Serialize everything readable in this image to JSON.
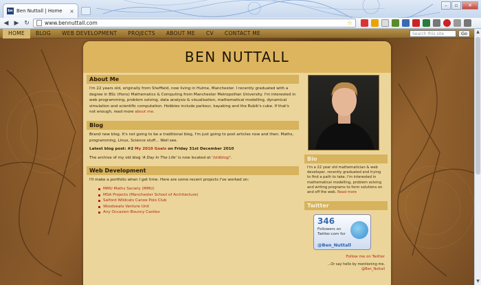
{
  "browser": {
    "tab_title": "Ben Nuttall | Home",
    "favicon_text": "bn",
    "url": "www.bennuttall.com"
  },
  "nav": {
    "items": [
      "HOME",
      "BLOG",
      "WEB DEVELOPMENT",
      "PROJECTS",
      "ABOUT ME",
      "CV",
      "CONTACT ME"
    ],
    "search_placeholder": "Search this site",
    "go_label": "Go"
  },
  "site": {
    "title": "BEN NUTTALL"
  },
  "about": {
    "heading": "About Me",
    "text": "I'm 22 years old, originally from Sheffield, now living in Hulme, Manchester. I recently graduated with a degree in BSc (Hons) Mathematics & Computing from Manchester Metropolitan University. I'm interested in web programming, problem solving, data analysis & visualisation, mathematical modelling, dynamical simulation and scientific computation. Hobbies include parkour, kayaking and the Rubik's cube. If that's not enough, read more",
    "link": "about me",
    "link_suffix": "."
  },
  "blog": {
    "heading": "Blog",
    "intro": "Brand new blog. It's not going to be a traditional blog, I'm just going to post articles now and then. Maths, programming, Linux, Science stuff... Well see.",
    "latest_prefix": "Latest blog post: #2",
    "latest_link": "My 2010 Goals",
    "latest_suffix": "on Friday 31st December 2010",
    "archive_prefix": "The archive of my old blog '",
    "archive_title": "A Day In The Life",
    "archive_mid": "' is now located at '",
    "archive_link": "/oldblog/",
    "archive_suffix": "'."
  },
  "webdev": {
    "heading": "Web Development",
    "intro": "I'll make a portfolio when I get time. Here are some recent projects I've worked on:",
    "projects": [
      "MMU Maths Society (MMU)",
      "MSA Projects (Manchester School of Architecture)",
      "Salford Wildcats Canoe Polo Club",
      "Woodseats Venture Unit",
      "Any Occasion Bouncy Castles"
    ]
  },
  "bio": {
    "heading": "Bio",
    "text": "I'm a 22 year old mathematician & web developer, recently graduated and trying to find a path to take. I'm interested in mathematical modelling, problem solving and writing programs to form solutions on and off the web.",
    "link": "Read more"
  },
  "twitter": {
    "heading": "Twitter",
    "count": "346",
    "followers_line1": "Followers on",
    "followers_line2": "Twitter.com for",
    "handle": "@Ben_Nuttall",
    "follow_link": "Follow me on Twitter",
    "mention_text": "...Or say hello by mentioning me,",
    "mention_handle": "@Ben_Nuttall"
  },
  "colors": {
    "accent_link": "#b3241a",
    "card_bg": "#ebd59a",
    "section_head": "#d6b35c",
    "nav_bar": "#9f7a36"
  }
}
